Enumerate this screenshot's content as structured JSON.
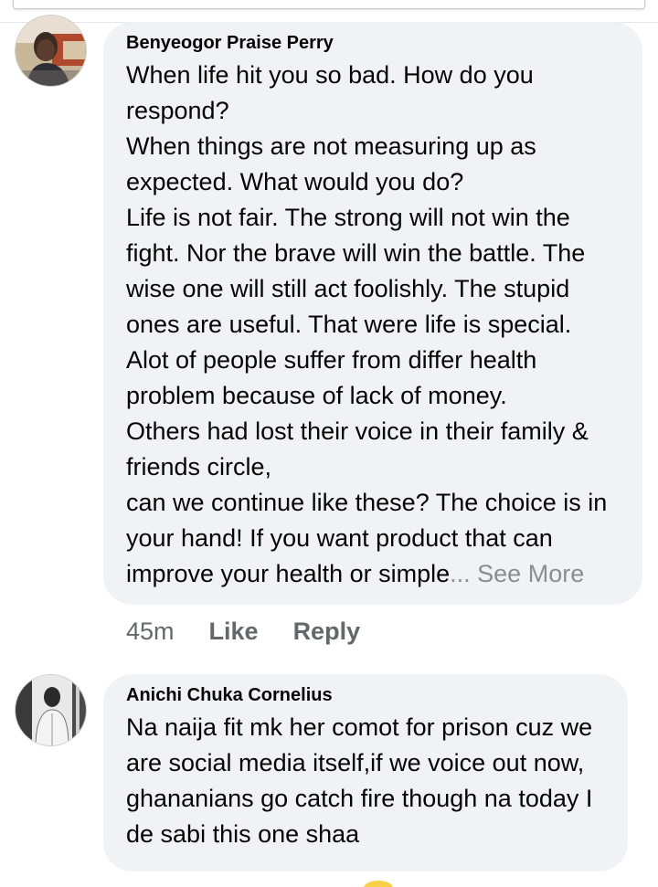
{
  "comments": [
    {
      "author": "Benyeogor Praise Perry",
      "text": "When life hit you so bad. How do you respond?\nWhen things are not measuring up as expected. What would you do?\nLife is not fair. The strong will not win the fight. Nor the brave will win the battle. The wise one will still act foolishly. The stupid ones are useful. That were life is special.\nAlot of people suffer from differ health problem because of lack of money.\nOthers had lost their voice in their family & friends circle,\ncan we continue like these? The choice is in your hand! If you want product that can improve your health or simple",
      "see_more": "... See More",
      "time": "45m",
      "like_label": "Like",
      "reply_label": "Reply"
    },
    {
      "author": "Anichi Chuka Cornelius",
      "text": "Na naija fit mk her comot for prison cuz we are social media itself,if we voice out now, ghananians go catch fire though na today I de sabi this one shaa"
    }
  ],
  "colors": {
    "bubble": "#f0f2f5",
    "text": "#050505",
    "secondary": "#65676b",
    "see_more": "#8a8d91"
  }
}
